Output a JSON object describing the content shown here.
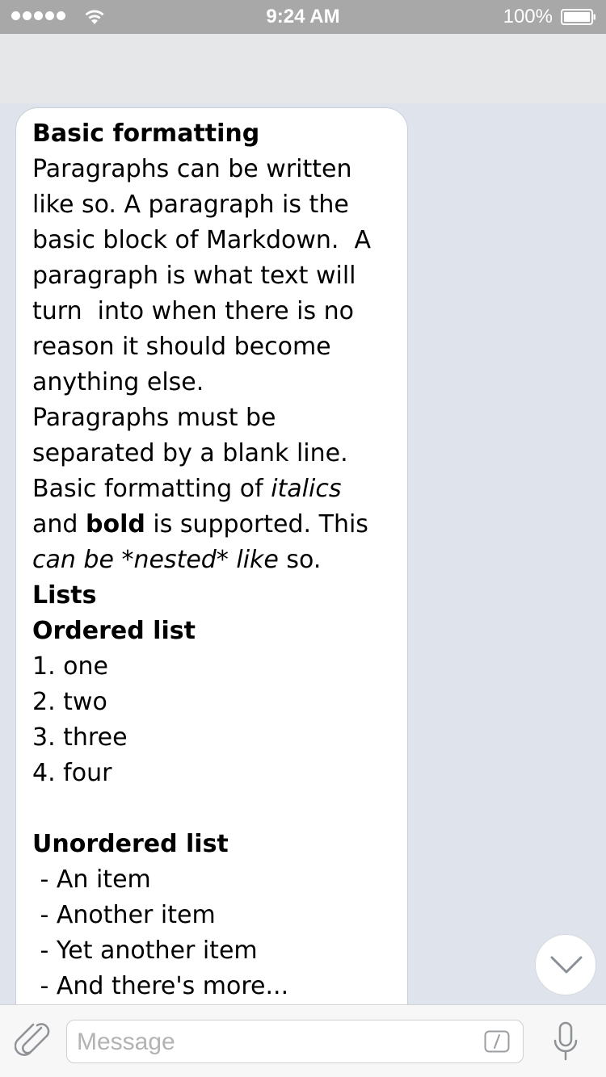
{
  "status_bar": {
    "time": "9:24 AM",
    "battery": "100%"
  },
  "message": {
    "lines": [
      {
        "segments": [
          {
            "text": "Basic formatting",
            "style": "bold"
          }
        ]
      },
      {
        "segments": [
          {
            "text": "Paragraphs can be written",
            "style": "normal"
          }
        ]
      },
      {
        "segments": [
          {
            "text": "like so. A paragraph is the",
            "style": "normal"
          }
        ]
      },
      {
        "segments": [
          {
            "text": "basic block of Markdown.  A",
            "style": "normal"
          }
        ]
      },
      {
        "segments": [
          {
            "text": "paragraph is what text will",
            "style": "normal"
          }
        ]
      },
      {
        "segments": [
          {
            "text": "turn  into when there is no",
            "style": "normal"
          }
        ]
      },
      {
        "segments": [
          {
            "text": "reason it should become",
            "style": "normal"
          }
        ]
      },
      {
        "segments": [
          {
            "text": "anything else.",
            "style": "normal"
          }
        ]
      },
      {
        "segments": [
          {
            "text": "Paragraphs must be",
            "style": "normal"
          }
        ]
      },
      {
        "segments": [
          {
            "text": "separated by a blank line.",
            "style": "normal"
          }
        ]
      },
      {
        "segments": [
          {
            "text": "Basic formatting of ",
            "style": "normal"
          },
          {
            "text": "italics",
            "style": "italic"
          }
        ]
      },
      {
        "segments": [
          {
            "text": "and ",
            "style": "normal"
          },
          {
            "text": "bold",
            "style": "bold"
          },
          {
            "text": " is supported. This",
            "style": "normal"
          }
        ]
      },
      {
        "segments": [
          {
            "text": "can be *nested* like",
            "style": "italic"
          },
          {
            "text": " so.",
            "style": "normal"
          }
        ]
      },
      {
        "segments": [
          {
            "text": "Lists",
            "style": "bold"
          }
        ]
      },
      {
        "segments": [
          {
            "text": "Ordered list",
            "style": "bold"
          }
        ]
      },
      {
        "segments": [
          {
            "text": "1. one",
            "style": "normal"
          }
        ]
      },
      {
        "segments": [
          {
            "text": "2. two",
            "style": "normal"
          }
        ]
      },
      {
        "segments": [
          {
            "text": "3. three",
            "style": "normal"
          }
        ]
      },
      {
        "segments": [
          {
            "text": "4. four",
            "style": "normal"
          }
        ]
      },
      {
        "segments": [
          {
            "text": "",
            "style": "normal"
          }
        ]
      },
      {
        "segments": [
          {
            "text": "Unordered list",
            "style": "bold"
          }
        ]
      },
      {
        "segments": [
          {
            "text": " - An item",
            "style": "normal"
          }
        ]
      },
      {
        "segments": [
          {
            "text": " - Another item",
            "style": "normal"
          }
        ]
      },
      {
        "segments": [
          {
            "text": " - Yet another item",
            "style": "normal"
          }
        ]
      },
      {
        "segments": [
          {
            "text": " - And there's more...",
            "style": "normal"
          }
        ]
      }
    ]
  },
  "scroll_down": {
    "icon": "chevron-down-icon"
  },
  "input_bar": {
    "attach_icon": "paperclip-icon",
    "placeholder": "Message",
    "command_icon": "slash-command-icon",
    "mic_icon": "microphone-icon"
  }
}
